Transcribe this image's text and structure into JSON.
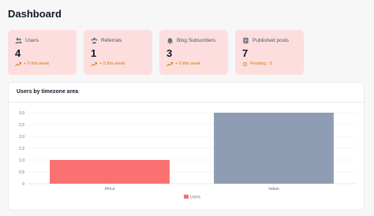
{
  "page": {
    "title": "Dashboard"
  },
  "cards": [
    {
      "label": "Users",
      "icon": "users-icon",
      "value": "4",
      "note": "+ 0 this week",
      "note_icon": "trend-up-icon"
    },
    {
      "label": "Referrals",
      "icon": "referrals-icon",
      "value": "1",
      "note": "+ 0 this week",
      "note_icon": "trend-up-icon"
    },
    {
      "label": "Blog Subscribers",
      "icon": "subscribers-icon",
      "value": "3",
      "note": "+ 0 this week",
      "note_icon": "trend-up-icon"
    },
    {
      "label": "Published posts",
      "icon": "posts-icon",
      "value": "7",
      "note": "Pending : 0",
      "note_icon": "clock-icon"
    }
  ],
  "chart_panel": {
    "title": "Users by timezone area"
  },
  "chart_data": {
    "type": "bar",
    "title": "Users by timezone area",
    "categories": [
      "Africa",
      "Indian"
    ],
    "series": [
      {
        "name": "Users",
        "values": [
          1,
          3
        ],
        "colors": [
          "#fb7070",
          "#8e9db3"
        ]
      }
    ],
    "yticks": [
      "0",
      "0,5",
      "1,0",
      "1,5",
      "2,0",
      "2,5",
      "3,0"
    ],
    "ylim": [
      0,
      3
    ],
    "grid": true,
    "legend_position": "bottom"
  },
  "colors": {
    "card_background": "#fddede",
    "accent": "#d97706",
    "africa_bar": "#fb7070",
    "indian_bar": "#8e9db3",
    "legend_swatch": "#fb7070"
  }
}
